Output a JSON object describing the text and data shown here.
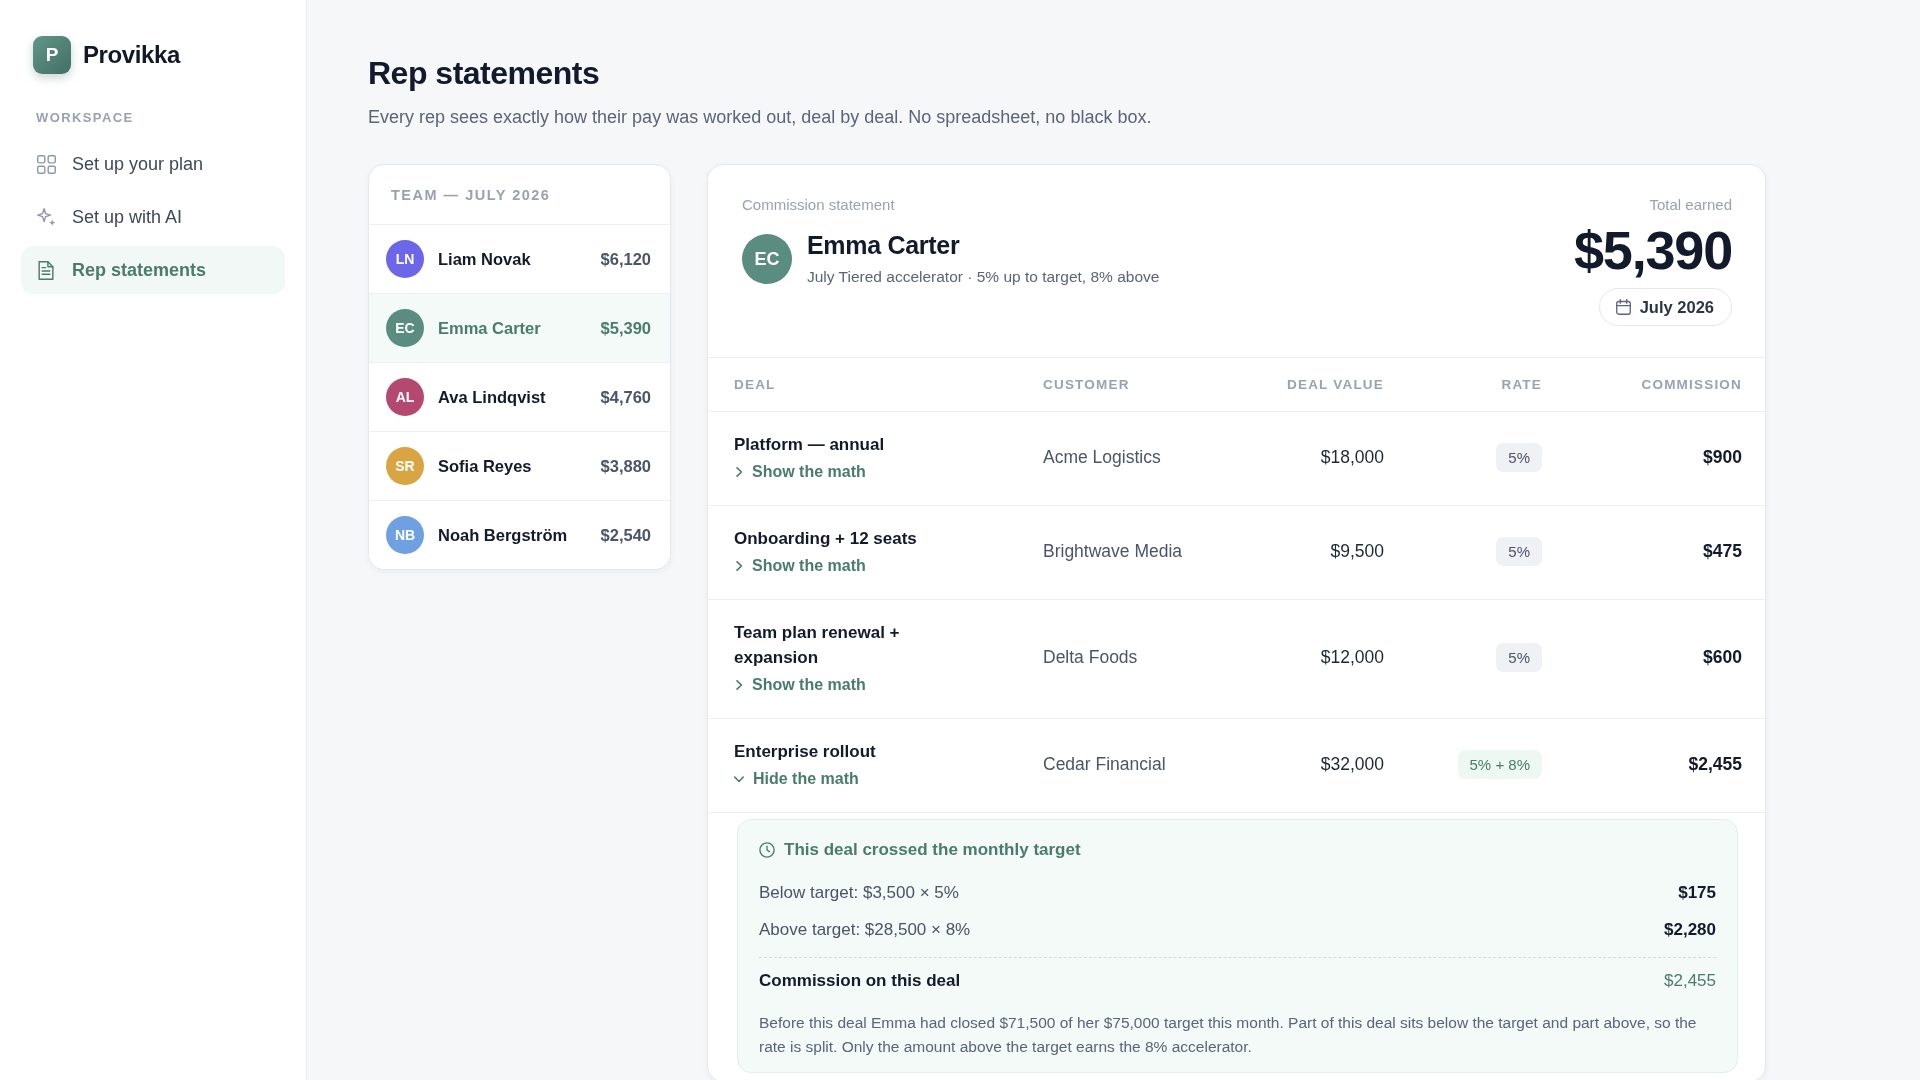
{
  "sidebar": {
    "brand": {
      "mark": "P",
      "name": "Provikka"
    },
    "section": "WORKSPACE",
    "items": [
      {
        "label": "Set up your plan",
        "selected": false
      },
      {
        "label": "Set up with AI",
        "selected": false
      },
      {
        "label": "Rep statements",
        "selected": true
      }
    ]
  },
  "page": {
    "title": "Rep statements",
    "subtitle": "Every rep sees exactly how their pay was worked out, deal by deal. No spreadsheet, no black box."
  },
  "team": {
    "title": "TEAM — JULY 2026",
    "reps": [
      {
        "initials": "LN",
        "name": "Liam Novak",
        "total": "$6,120",
        "color": "#6c66e8",
        "selected": false
      },
      {
        "initials": "EC",
        "name": "Emma Carter",
        "total": "$5,390",
        "color": "#5b8c80",
        "selected": true
      },
      {
        "initials": "AL",
        "name": "Ava Lindqvist",
        "total": "$4,760",
        "color": "#b5486f",
        "selected": false
      },
      {
        "initials": "SR",
        "name": "Sofia Reyes",
        "total": "$3,880",
        "color": "#d9a542",
        "selected": false
      },
      {
        "initials": "NB",
        "name": "Noah Bergström",
        "total": "$2,540",
        "color": "#6fa0e2",
        "selected": false
      }
    ]
  },
  "statement": {
    "label": "Commission statement",
    "rep": {
      "initials": "EC",
      "name": "Emma Carter",
      "plan": "July Tiered accelerator · 5% up to target, 8% above"
    },
    "total_label": "Total earned",
    "total": "$5,390",
    "period": "July 2026",
    "table": {
      "columns": [
        "DEAL",
        "CUSTOMER",
        "DEAL VALUE",
        "RATE",
        "COMMISSION"
      ],
      "rows": [
        {
          "deal": "Platform — annual",
          "toggle": "Show the math",
          "expanded": false,
          "customer": "Acme Logistics",
          "value": "$18,000",
          "rate": {
            "text": "5%",
            "kind": "flat"
          },
          "commission": "$900"
        },
        {
          "deal": "Onboarding + 12 seats",
          "toggle": "Show the math",
          "expanded": false,
          "customer": "Brightwave Media",
          "value": "$9,500",
          "rate": {
            "text": "5%",
            "kind": "flat"
          },
          "commission": "$475"
        },
        {
          "deal": "Team plan renewal + expansion",
          "toggle": "Show the math",
          "expanded": false,
          "customer": "Delta Foods",
          "value": "$12,000",
          "rate": {
            "text": "5%",
            "kind": "flat"
          },
          "commission": "$600"
        },
        {
          "deal": "Enterprise rollout",
          "toggle": "Hide the math",
          "expanded": true,
          "customer": "Cedar Financial",
          "value": "$32,000",
          "rate": {
            "text": "5% + 8%",
            "kind": "split"
          },
          "commission": "$2,455",
          "breakdown": {
            "title": "This deal crossed the monthly target",
            "lines": [
              {
                "label": "Below target: $3,500 × 5%",
                "amount": "$175"
              },
              {
                "label": "Above target: $28,500 × 8%",
                "amount": "$2,280"
              }
            ],
            "total_label": "Commission on this deal",
            "total": "$2,455",
            "note": "Before this deal Emma had closed $71,500 of her $75,000 target this month. Part of this deal sits below the target and part above, so the rate is split. Only the amount above the target earns the 8% accelerator."
          }
        }
      ]
    }
  }
}
